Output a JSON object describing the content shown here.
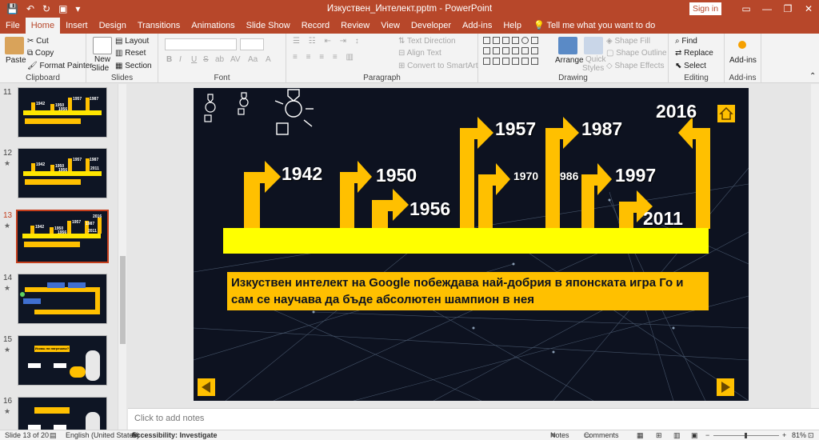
{
  "window": {
    "doc_title": "Изкуствен_Интелект.pptm  -  PowerPoint",
    "signin_label": "Sign in",
    "controls": [
      "—",
      "❐",
      "✕"
    ],
    "accent_color": "#b7472a"
  },
  "tabs": [
    "File",
    "Home",
    "Insert",
    "Design",
    "Transitions",
    "Animations",
    "Slide Show",
    "Record",
    "Review",
    "View",
    "Developer",
    "Add-ins",
    "Help"
  ],
  "active_tab": "Home",
  "tell_me": "Tell me what you want to do",
  "ribbon": {
    "clipboard": {
      "label": "Clipboard",
      "paste": "Paste",
      "cut": "Cut",
      "copy": "Copy",
      "format_painter": "Format Painter"
    },
    "slides": {
      "label": "Slides",
      "new_slide": "New",
      "new_slide_2": "Slide",
      "layout": "Layout",
      "reset": "Reset",
      "section": "Section"
    },
    "font": {
      "label": "Font",
      "buttons": [
        "B",
        "I",
        "U",
        "S",
        "ab",
        "AV",
        "Aa",
        "A"
      ]
    },
    "paragraph": {
      "label": "Paragraph",
      "text_direction": "Text Direction",
      "align_text": "Align Text",
      "convert_smartart": "Convert to SmartArt"
    },
    "drawing": {
      "label": "Drawing",
      "arrange": "Arrange",
      "quick_styles": "Quick",
      "quick_styles_2": "Styles",
      "shape_fill": "Shape Fill",
      "shape_outline": "Shape Outline",
      "shape_effects": "Shape Effects"
    },
    "editing": {
      "label": "Editing",
      "find": "Find",
      "replace": "Replace",
      "select": "Select"
    },
    "addins": {
      "label": "Add-ins",
      "button": "Add-ins"
    }
  },
  "thumbnails": [
    {
      "num": "11"
    },
    {
      "num": "12"
    },
    {
      "num": "13"
    },
    {
      "num": "14"
    },
    {
      "num": "15"
    },
    {
      "num": "16"
    }
  ],
  "thumbnail_texts": {
    "t11": [
      "1942",
      "1950",
      "1956",
      "1957",
      "1987"
    ],
    "t12": [
      "1942",
      "1950",
      "1956",
      "1957",
      "1987",
      "2011"
    ],
    "t13": [
      "1942",
      "1950",
      "1956",
      "1957",
      "1987",
      "2011",
      "2016"
    ],
    "t15": "Искаш ли нагрешиш?"
  },
  "slide": {
    "years": {
      "y1942": "1942",
      "y1950": "1950",
      "y1956": "1956",
      "y1957": "1957",
      "y1970": "1970",
      "y1986": "986",
      "y1987": "1987",
      "y1997": "1997",
      "y2011": "2011",
      "y2016": "2016"
    },
    "caption": "Изкуствен интелект на Google побеждава най-добрия в японската игра Го и сам се научава да бъде абсолютен шампион в нея",
    "colors": {
      "bar": "#ffff00",
      "arrow": "#ffc000",
      "background": "#0d1220"
    }
  },
  "notes_placeholder": "Click to add notes",
  "status": {
    "slide_of": "Slide 13 of 20",
    "language": "English (United States)",
    "accessibility": "Accessibility: Investigate",
    "notes": "Notes",
    "comments": "Comments",
    "zoom": "81%"
  }
}
